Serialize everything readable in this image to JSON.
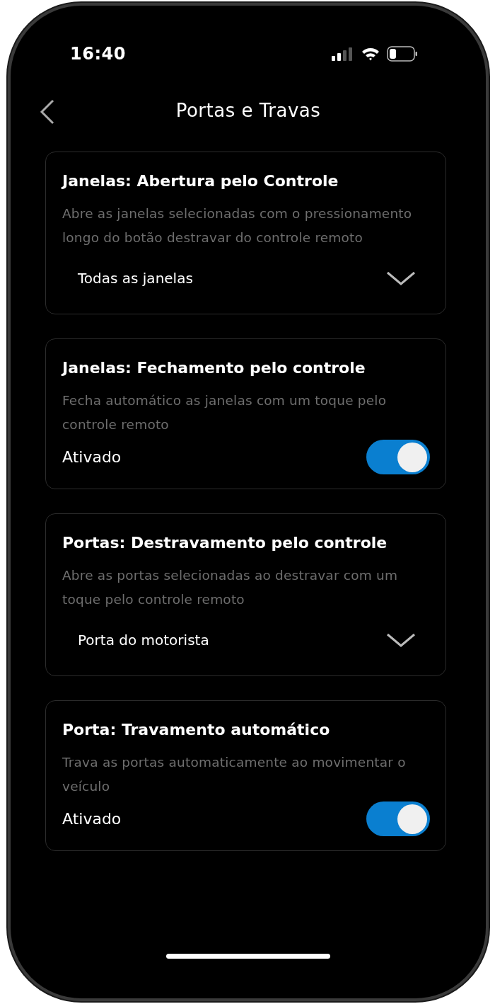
{
  "status_bar": {
    "time": "16:40"
  },
  "header": {
    "title": "Portas e Travas"
  },
  "settings": [
    {
      "kind": "dropdown",
      "title": "Janelas: Abertura pelo Controle",
      "description": "Abre as janelas selecionadas com o pressionamento longo do botão destravar do controle remoto",
      "value": "Todas as janelas"
    },
    {
      "kind": "toggle",
      "title": "Janelas: Fechamento pelo controle",
      "description": "Fecha automático as janelas com um toque pelo controle remoto",
      "label": "Ativado",
      "on": true
    },
    {
      "kind": "dropdown",
      "title": "Portas: Destravamento pelo controle",
      "description": "Abre as portas selecionadas ao destravar com um toque pelo controle remoto",
      "value": "Porta do motorista"
    },
    {
      "kind": "toggle",
      "title": "Porta: Travamento automático",
      "description": "Trava as portas automaticamente ao movimentar o veículo",
      "label": "Ativado",
      "on": true
    }
  ]
}
